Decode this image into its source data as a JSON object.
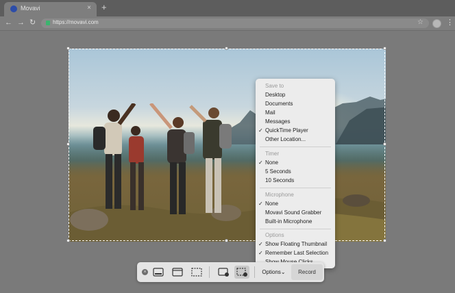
{
  "browser": {
    "tab_title": "Movavi",
    "tab_close": "×",
    "new_tab": "+",
    "back": "←",
    "forward": "→",
    "reload": "↻",
    "url": "https://movavi.com",
    "star": "☆",
    "menu": "⋮"
  },
  "menu": {
    "save_to": {
      "header": "Save to",
      "items": [
        {
          "label": "Desktop",
          "checked": false
        },
        {
          "label": "Documents",
          "checked": false
        },
        {
          "label": "Mail",
          "checked": false
        },
        {
          "label": "Messages",
          "checked": false
        },
        {
          "label": "QuickTime Player",
          "checked": true
        },
        {
          "label": "Other Location...",
          "checked": false
        }
      ]
    },
    "timer": {
      "header": "Timer",
      "items": [
        {
          "label": "None",
          "checked": true
        },
        {
          "label": "5 Seconds",
          "checked": false
        },
        {
          "label": "10 Seconds",
          "checked": false
        }
      ]
    },
    "microphone": {
      "header": "Microphone",
      "items": [
        {
          "label": "None",
          "checked": true
        },
        {
          "label": "Movavi Sound Grabber",
          "checked": false
        },
        {
          "label": "Built-in Microphone",
          "checked": false
        }
      ]
    },
    "options": {
      "header": "Options",
      "items": [
        {
          "label": "Show Floating Thumbnail",
          "checked": true
        },
        {
          "label": "Remember Last Selection",
          "checked": true
        },
        {
          "label": "Show Mouse Clicks",
          "checked": false
        }
      ]
    },
    "check_glyph": "✓"
  },
  "toolbar": {
    "close": "×",
    "options_label": "Options⌄",
    "record_label": "Record",
    "active_tool": "record-selected-portion"
  },
  "colors": {
    "accent_favicon": "#2d4da8",
    "lock_green": "#3bb46e"
  }
}
